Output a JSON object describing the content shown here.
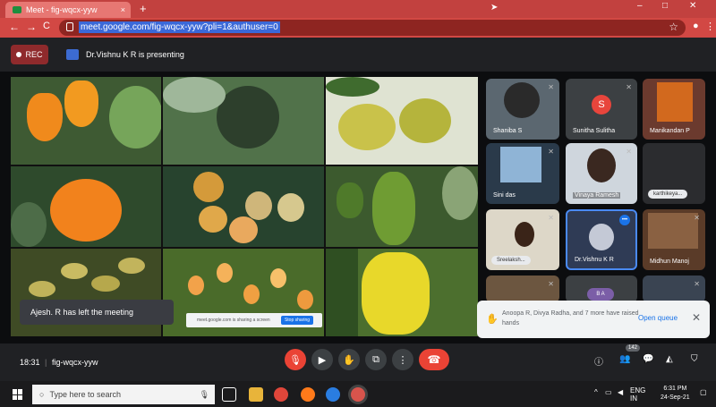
{
  "browser": {
    "tab_title": "Meet - fig-wqcx-yyw",
    "tab_close": "×",
    "new_tab": "+",
    "window_controls": [
      "–",
      "□",
      "✕"
    ],
    "url": "meet.google.com/fig-wqcx-yyw?pli=1&authuser=0",
    "nav_back": "←",
    "nav_forward": "→",
    "nav_reload": "C"
  },
  "meet": {
    "rec_label": "REC",
    "presenting_text": "Dr.Vishnu K R is presenting",
    "left_meeting_toast": "Ajesh. R has left the meeting",
    "share_bar_text": "meet.google.com is sharing a screen",
    "share_bar_stop": "Stop sharing",
    "participants": [
      {
        "name": "Shaniba S",
        "avatar": ""
      },
      {
        "name": "Sunitha Sulitha",
        "avatar": "S"
      },
      {
        "name": "Manikandan P",
        "avatar": ""
      },
      {
        "name": "Sini das",
        "avatar": ""
      },
      {
        "name": "Vinaya Ramesh",
        "avatar": ""
      },
      {
        "name": "karthikeya...",
        "avatar": ""
      },
      {
        "name": "Sreelaksh...",
        "avatar": ""
      },
      {
        "name": "Dr.Vishnu K R",
        "avatar": ""
      },
      {
        "name": "Midhun Manoj",
        "avatar": ""
      },
      {
        "name": "",
        "avatar": ""
      },
      {
        "name": "",
        "avatar": "B A"
      },
      {
        "name": "",
        "avatar": ""
      }
    ],
    "raised_hands_text": "Anoopa R, Divya Radha, and 7 more have raised hands",
    "open_queue": "Open queue",
    "close": "✕",
    "time": "18:31",
    "meeting_code": "fig-wqcx-yyw",
    "people_count": "142"
  },
  "taskbar": {
    "search_placeholder": "Type here to search",
    "lang_line1": "ENG",
    "lang_line2": "IN",
    "clock_time": "6:31 PM",
    "clock_date": "24-Sep-21"
  },
  "colors": {
    "browser_accent": "#c2413f",
    "meet_bg": "#202124",
    "leave_red": "#ea4335",
    "speaking_blue": "#1a73e8"
  }
}
